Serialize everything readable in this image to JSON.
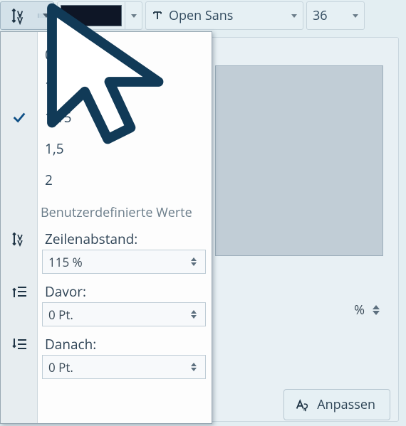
{
  "toolbar": {
    "font_name": "Open Sans",
    "font_size": "36"
  },
  "dropdown": {
    "options": [
      "0,85",
      "1",
      "1,15",
      "1,5",
      "2"
    ],
    "selected_index": 2,
    "custom_header": "Benutzerdefinierte Werte",
    "line_spacing": {
      "label": "Zeilenabstand:",
      "value": "115 %"
    },
    "before": {
      "label": "Davor:",
      "value": "0 Pt."
    },
    "after": {
      "label": "Danach:",
      "value": "0 Pt."
    }
  },
  "panel": {
    "spinner_unit": "%",
    "anpassen_label": "Anpassen"
  }
}
